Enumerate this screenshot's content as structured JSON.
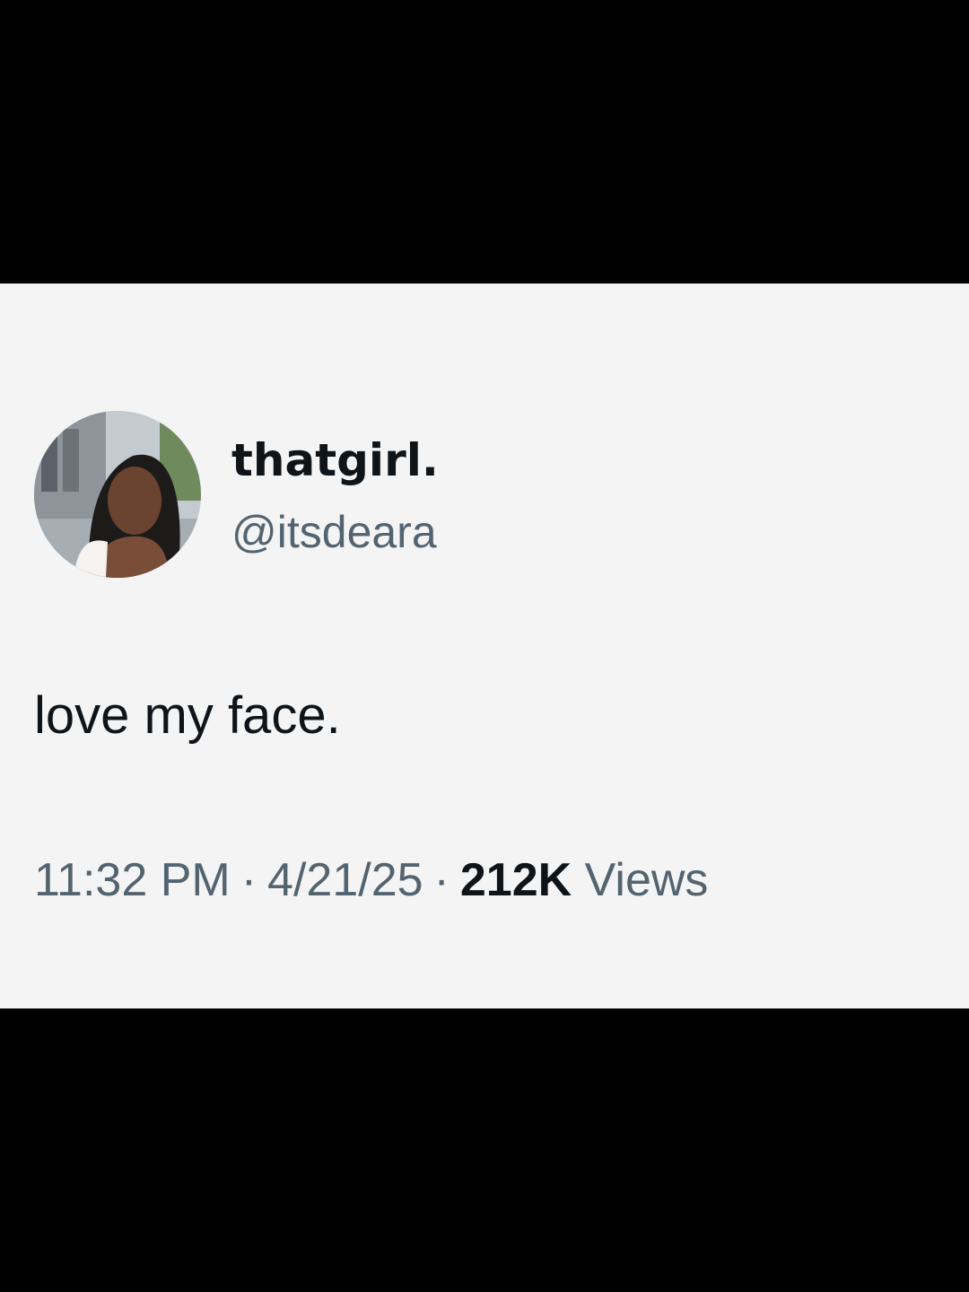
{
  "colors": {
    "background": "#000000",
    "card": "#f4f4f5",
    "primary_text": "#0f1419",
    "secondary_text": "#536471"
  },
  "author": {
    "display_name": "thatgirl.",
    "handle": "@itsdeara",
    "avatar": "profile-photo"
  },
  "tweet": {
    "text": "love my face."
  },
  "meta": {
    "time": "11:32 PM",
    "separator": "·",
    "date": "4/21/25",
    "views_count": "212K",
    "views_label": "Views"
  }
}
